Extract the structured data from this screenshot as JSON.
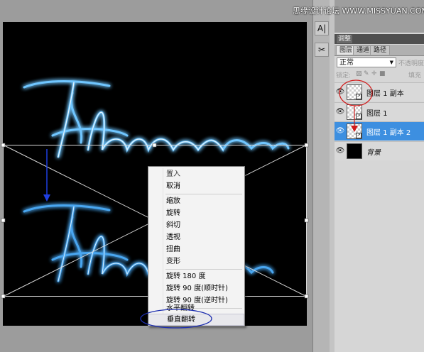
{
  "watermark": "思缘设计论坛 WWW.MISSYUAN.COM",
  "tools": {
    "text_tool_icon": "A|",
    "transform_tool_icon": "✂"
  },
  "layers_panel": {
    "adjust_tab": "调整",
    "tabs": [
      {
        "label": "图层",
        "active": true
      },
      {
        "label": "通道",
        "active": false
      },
      {
        "label": "路径",
        "active": false
      }
    ],
    "blend_mode": "正常",
    "opacity_label": "不透明度",
    "lock_label": "锁定:",
    "fill_label": "填充",
    "layers": [
      {
        "name": "图层 1 副本",
        "visible": true,
        "selected": false,
        "thumb": "transparent",
        "smart": true
      },
      {
        "name": "图层 1",
        "visible": true,
        "selected": false,
        "thumb": "transparent",
        "smart": true
      },
      {
        "name": "图层 1 副本 2",
        "visible": true,
        "selected": true,
        "thumb": "transparent",
        "smart": true
      },
      {
        "name": "背景",
        "visible": true,
        "selected": false,
        "thumb": "black",
        "smart": false
      }
    ]
  },
  "context_menu": {
    "items": [
      {
        "label": "置入",
        "disabled": true
      },
      {
        "label": "取消",
        "disabled": false
      },
      {
        "separator": true
      },
      {
        "label": "缩放",
        "disabled": false
      },
      {
        "label": "旋转",
        "disabled": false
      },
      {
        "label": "斜切",
        "disabled": false
      },
      {
        "label": "透视",
        "disabled": false
      },
      {
        "label": "扭曲",
        "disabled": false
      },
      {
        "label": "变形",
        "disabled": false
      },
      {
        "separator": true
      },
      {
        "label": "旋转 180 度",
        "disabled": false
      },
      {
        "label": "旋转 90 度(顺时针)",
        "disabled": false
      },
      {
        "label": "旋转 90 度(逆时针)",
        "disabled": false
      },
      {
        "separator": true
      },
      {
        "label": "水平翻转",
        "disabled": false
      },
      {
        "label": "垂直翻转",
        "disabled": false,
        "highlighted": true
      }
    ]
  },
  "colors": {
    "neon": "#55b8ff",
    "selected_layer": "#3d8fe0",
    "annotation_red": "#d11a1a",
    "annotation_blue": "#1e2fb0"
  }
}
